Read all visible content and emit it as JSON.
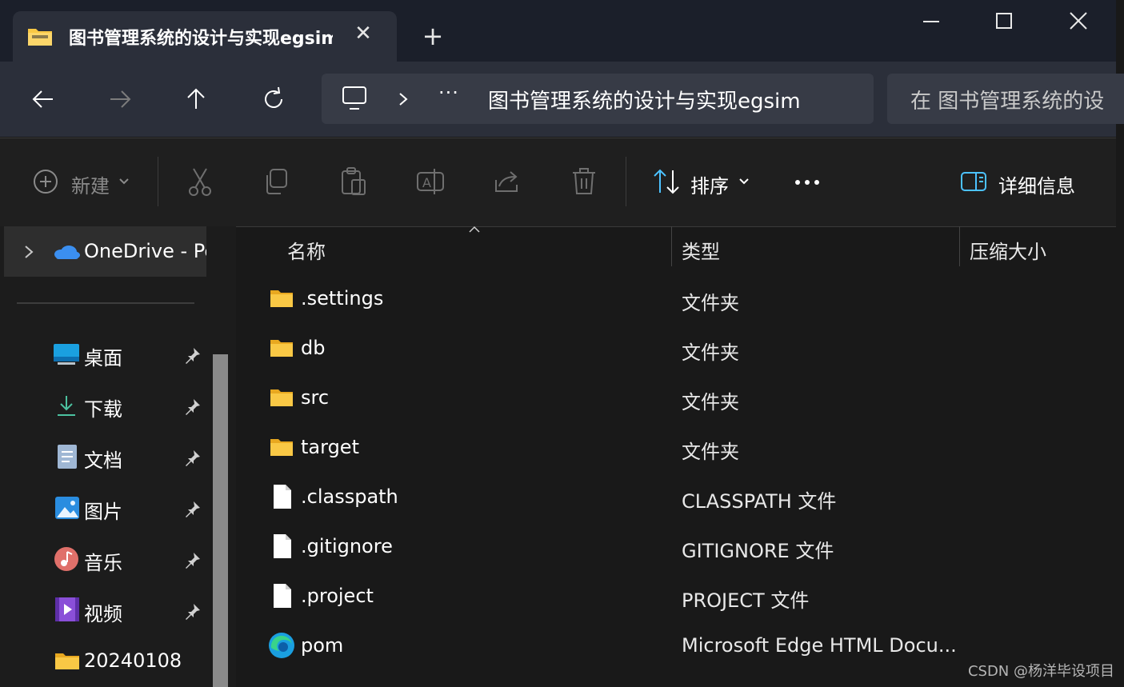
{
  "tab": {
    "title": "图书管理系统的设计与实现egsim"
  },
  "address": {
    "path": "图书管理系统的设计与实现egsim",
    "ellipsis": "···"
  },
  "search": {
    "placeholder": "在 图书管理系统的设"
  },
  "toolbar": {
    "new_label": "新建",
    "sort_label": "排序",
    "details_label": "详细信息"
  },
  "sidebar": {
    "onedrive": "OneDrive - Pe",
    "items": [
      {
        "label": "桌面",
        "icon": "desktop-icon",
        "pinned": true
      },
      {
        "label": "下载",
        "icon": "download-icon",
        "pinned": true
      },
      {
        "label": "文档",
        "icon": "document-icon",
        "pinned": true
      },
      {
        "label": "图片",
        "icon": "pictures-icon",
        "pinned": true
      },
      {
        "label": "音乐",
        "icon": "music-icon",
        "pinned": true
      },
      {
        "label": "视频",
        "icon": "video-icon",
        "pinned": true
      },
      {
        "label": "20240108",
        "icon": "folder-icon",
        "pinned": false
      }
    ]
  },
  "columns": {
    "name": "名称",
    "type": "类型",
    "size": "压缩大小"
  },
  "files": [
    {
      "name": ".settings",
      "type": "文件夹",
      "icon": "folder-icon"
    },
    {
      "name": "db",
      "type": "文件夹",
      "icon": "folder-icon"
    },
    {
      "name": "src",
      "type": "文件夹",
      "icon": "folder-icon"
    },
    {
      "name": "target",
      "type": "文件夹",
      "icon": "folder-icon"
    },
    {
      "name": ".classpath",
      "type": "CLASSPATH 文件",
      "icon": "file-icon"
    },
    {
      "name": ".gitignore",
      "type": "GITIGNORE 文件",
      "icon": "file-icon"
    },
    {
      "name": ".project",
      "type": "PROJECT 文件",
      "icon": "file-icon"
    },
    {
      "name": "pom",
      "type": "Microsoft Edge HTML Docu...",
      "icon": "edge-icon"
    }
  ],
  "watermark": "CSDN @杨洋毕设项目",
  "colors": {
    "folder": "#f9c845",
    "accent": "#4cc2ff",
    "onedrive": "#3b8ff0"
  }
}
